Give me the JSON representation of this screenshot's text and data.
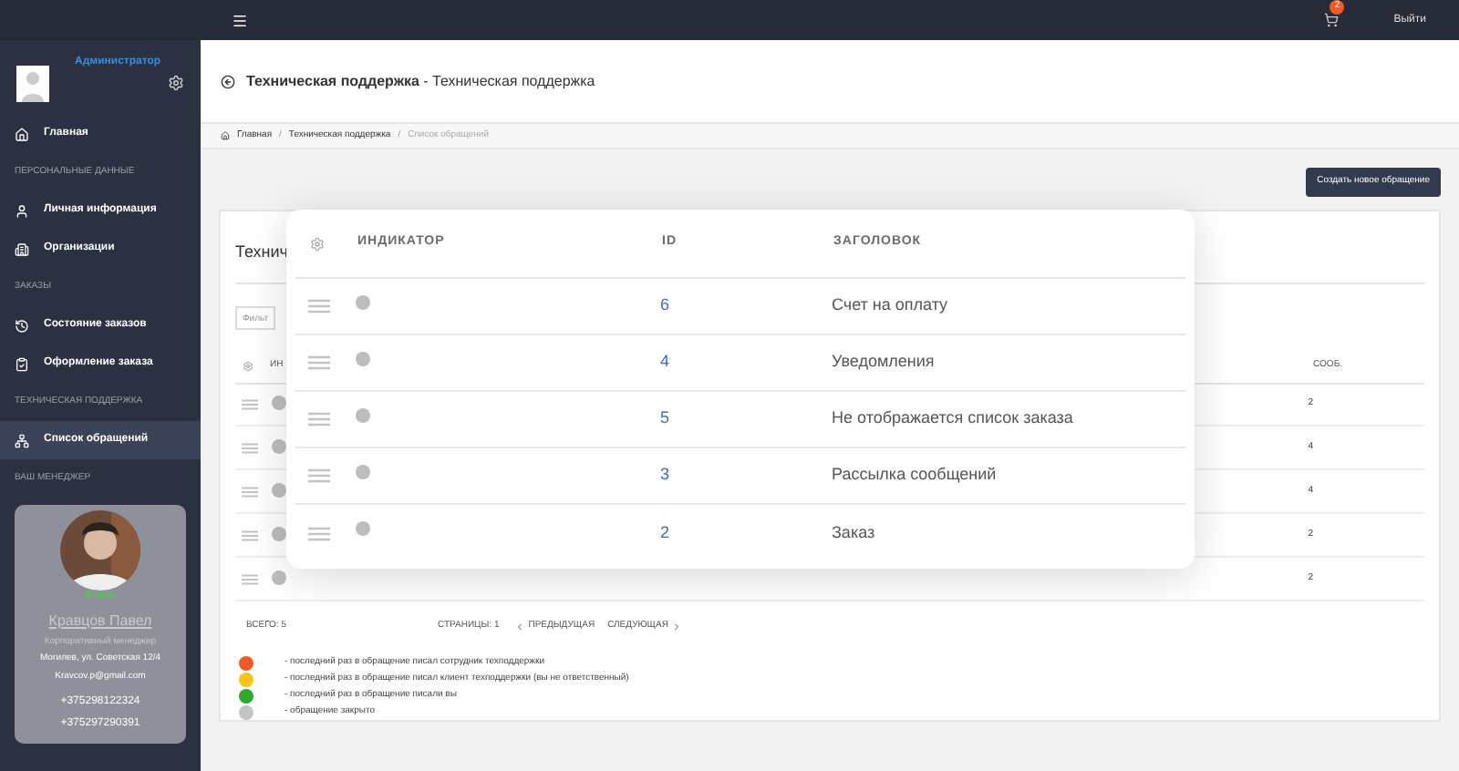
{
  "topbar": {
    "cart_count": "2",
    "logout": "Выйти"
  },
  "sidebar": {
    "user": "Администратор",
    "items": [
      {
        "kind": "link",
        "label": "Главная",
        "selected": false
      },
      {
        "kind": "section",
        "label": "ПЕРСОНАЛЬНЫЕ ДАННЫЕ"
      },
      {
        "kind": "link",
        "label": "Личная информация",
        "selected": false
      },
      {
        "kind": "link",
        "label": "Организации",
        "selected": false
      },
      {
        "kind": "section",
        "label": "ЗАКАЗЫ"
      },
      {
        "kind": "link",
        "label": "Состояние заказов",
        "selected": false
      },
      {
        "kind": "link",
        "label": "Оформление заказа",
        "selected": false
      },
      {
        "kind": "section",
        "label": "ТЕХНИЧЕСКАЯ ПОДДЕРЖКА"
      },
      {
        "kind": "link",
        "label": "Список обращений",
        "selected": true
      },
      {
        "kind": "section",
        "label": "ВАШ МЕНЕДЖЕР"
      }
    ],
    "manager": {
      "status": "В сети",
      "name": "Кравцов Павел",
      "role": "Корпоративный менеджер",
      "address": "Могилев, ул. Советская 12/4",
      "email": "Kravcov.p@gmail.com",
      "phones": [
        "+375298122324",
        "+375297290391"
      ]
    }
  },
  "page": {
    "title": "**Техническая поддержка** - Техническая поддержка",
    "breadcrumbs": [
      {
        "label": "Главная",
        "current": false
      },
      {
        "separator": "/",
        "label": "Техническая поддержка",
        "current": false
      },
      {
        "separator": "/",
        "label": "Список обращений",
        "current": true
      }
    ],
    "create_button": "Создать новое обращение"
  },
  "card": {
    "title": "Технич",
    "filter_placeholder": "Фильт",
    "columns": [
      "ИН",
      "СООБ."
    ],
    "rows": [
      {
        "color": "#bdbdbd",
        "messages": "2"
      },
      {
        "color": "#bdbdbd",
        "messages": "4"
      },
      {
        "color": "#bdbdbd",
        "messages": "4"
      },
      {
        "color": "#bdbdbd",
        "messages": "2"
      },
      {
        "color": "#bdbdbd",
        "messages": "2"
      }
    ],
    "total": "ВСЕГО: 5",
    "pages": "СТРАНИЦЫ: 1",
    "prev": "ПРЕДЫДУЩАЯ",
    "next": "СЛЕДУЮЩАЯ",
    "legend": [
      {
        "color": "#f05a28",
        "text": "- последний раз в обращение писал сотрудник техподдержки"
      },
      {
        "color": "#f5c518",
        "text": "- последний раз в обращение писал клиент техподдержки (вы не ответственный)"
      },
      {
        "color": "#2fa82f",
        "text": "- последний раз в обращение писали вы"
      },
      {
        "color": "#c4c4c4",
        "text": "- обращение закрыто"
      }
    ]
  },
  "drag_overlay": {
    "columns": [
      "ИНДИКАТОР",
      "ID",
      "ЗАГОЛОВОК"
    ],
    "rows": [
      {
        "color": "#bdbdbd",
        "id": "6",
        "subject": "Счет на оплату"
      },
      {
        "color": "#bdbdbd",
        "id": "4",
        "subject": "Уведомления"
      },
      {
        "color": "#bdbdbd",
        "id": "5",
        "subject": "Не отображается список заказа"
      },
      {
        "color": "#bdbdbd",
        "id": "3",
        "subject": "Рассылка сообщений"
      },
      {
        "color": "#bdbdbd",
        "id": "2",
        "subject": "Заказ"
      }
    ]
  }
}
